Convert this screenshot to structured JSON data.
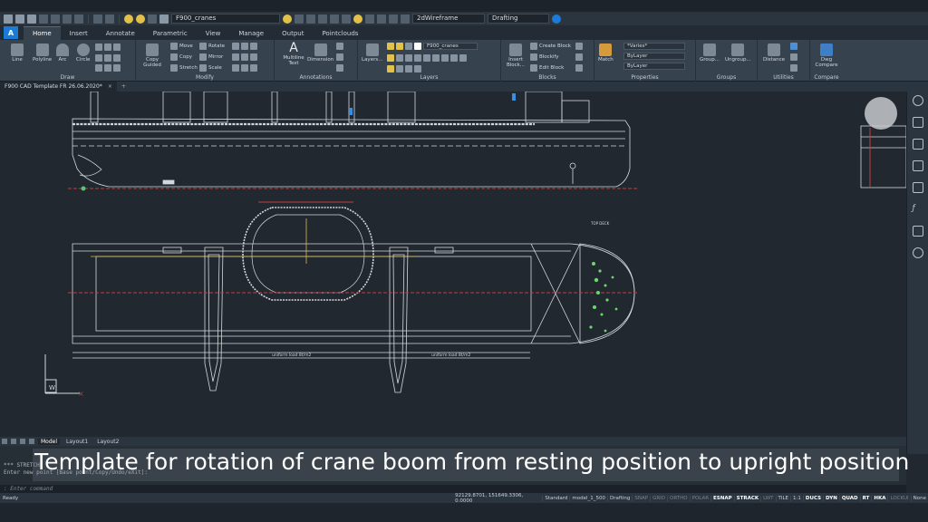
{
  "quick_access": {
    "layer_select": "F900_cranes",
    "visual_style": "2dWireframe",
    "workspace": "Drafting"
  },
  "tabs": [
    "Home",
    "Insert",
    "Annotate",
    "Parametric",
    "View",
    "Manage",
    "Output",
    "Pointclouds"
  ],
  "ribbon": {
    "draw": {
      "title": "Draw",
      "tools": [
        "Line",
        "Polyline",
        "Arc",
        "Circle"
      ]
    },
    "modify": {
      "title": "Modify",
      "copy_guided": "Copy Guided",
      "items": [
        "Move",
        "Copy",
        "Stretch",
        "Rotate",
        "Mirror",
        "Scale"
      ]
    },
    "annotations": {
      "title": "Annotations",
      "tools": [
        "Multiline Text",
        "Dimension"
      ]
    },
    "layers": {
      "title": "Layers",
      "button": "Layers...",
      "layer": "F900_cranes"
    },
    "blocks": {
      "title": "Blocks",
      "insert": "Insert Block...",
      "items": [
        "Create Block",
        "Blockify",
        "Edit Block"
      ]
    },
    "properties": {
      "title": "Properties",
      "match": "Match",
      "varies": "*Varies*",
      "bylayer1": "ByLayer",
      "bylayer2": "ByLayer"
    },
    "groups": {
      "title": "Groups",
      "tools": [
        "Group...",
        "Ungroup..."
      ]
    },
    "utilities": {
      "title": "Utilities",
      "tool": "Distance"
    },
    "compare": {
      "title": "Compare",
      "tool": "Dwg Compare"
    }
  },
  "doc_tab": "F900 CAD Template FR 26.06.2020*",
  "drawing": {
    "label_uniform1": "uniform load 8t/m2",
    "label_uniform2": "uniform load 8t/m2",
    "label_top": "TOP DECK",
    "axis_w": "W"
  },
  "layout_tabs": [
    "Model",
    "Layout1",
    "Layout2"
  ],
  "command": {
    "line1": "*** STRETCH",
    "line2": "Enter new point [Base point/Copy/Undo/eXit]:",
    "prompt": ": Enter command"
  },
  "caption": "Template for rotation of crane boom from resting position to upright position",
  "status": {
    "ready": "Ready",
    "coords": "92129.8701, 151649.3306, 0.0000",
    "items": [
      "Standard",
      "model_1_500",
      "Drafting",
      "SNAP",
      "GRID",
      "ORTHO",
      "POLAR",
      "ESNAP",
      "STRACK",
      "LWT",
      "TILE",
      "1:1",
      "DUCS",
      "DYN",
      "QUAD",
      "RT",
      "HKA",
      "LOCKUI",
      "None"
    ],
    "on_items": [
      "ESNAP",
      "STRACK",
      "DUCS",
      "DYN",
      "QUAD",
      "RT",
      "HKA"
    ]
  }
}
